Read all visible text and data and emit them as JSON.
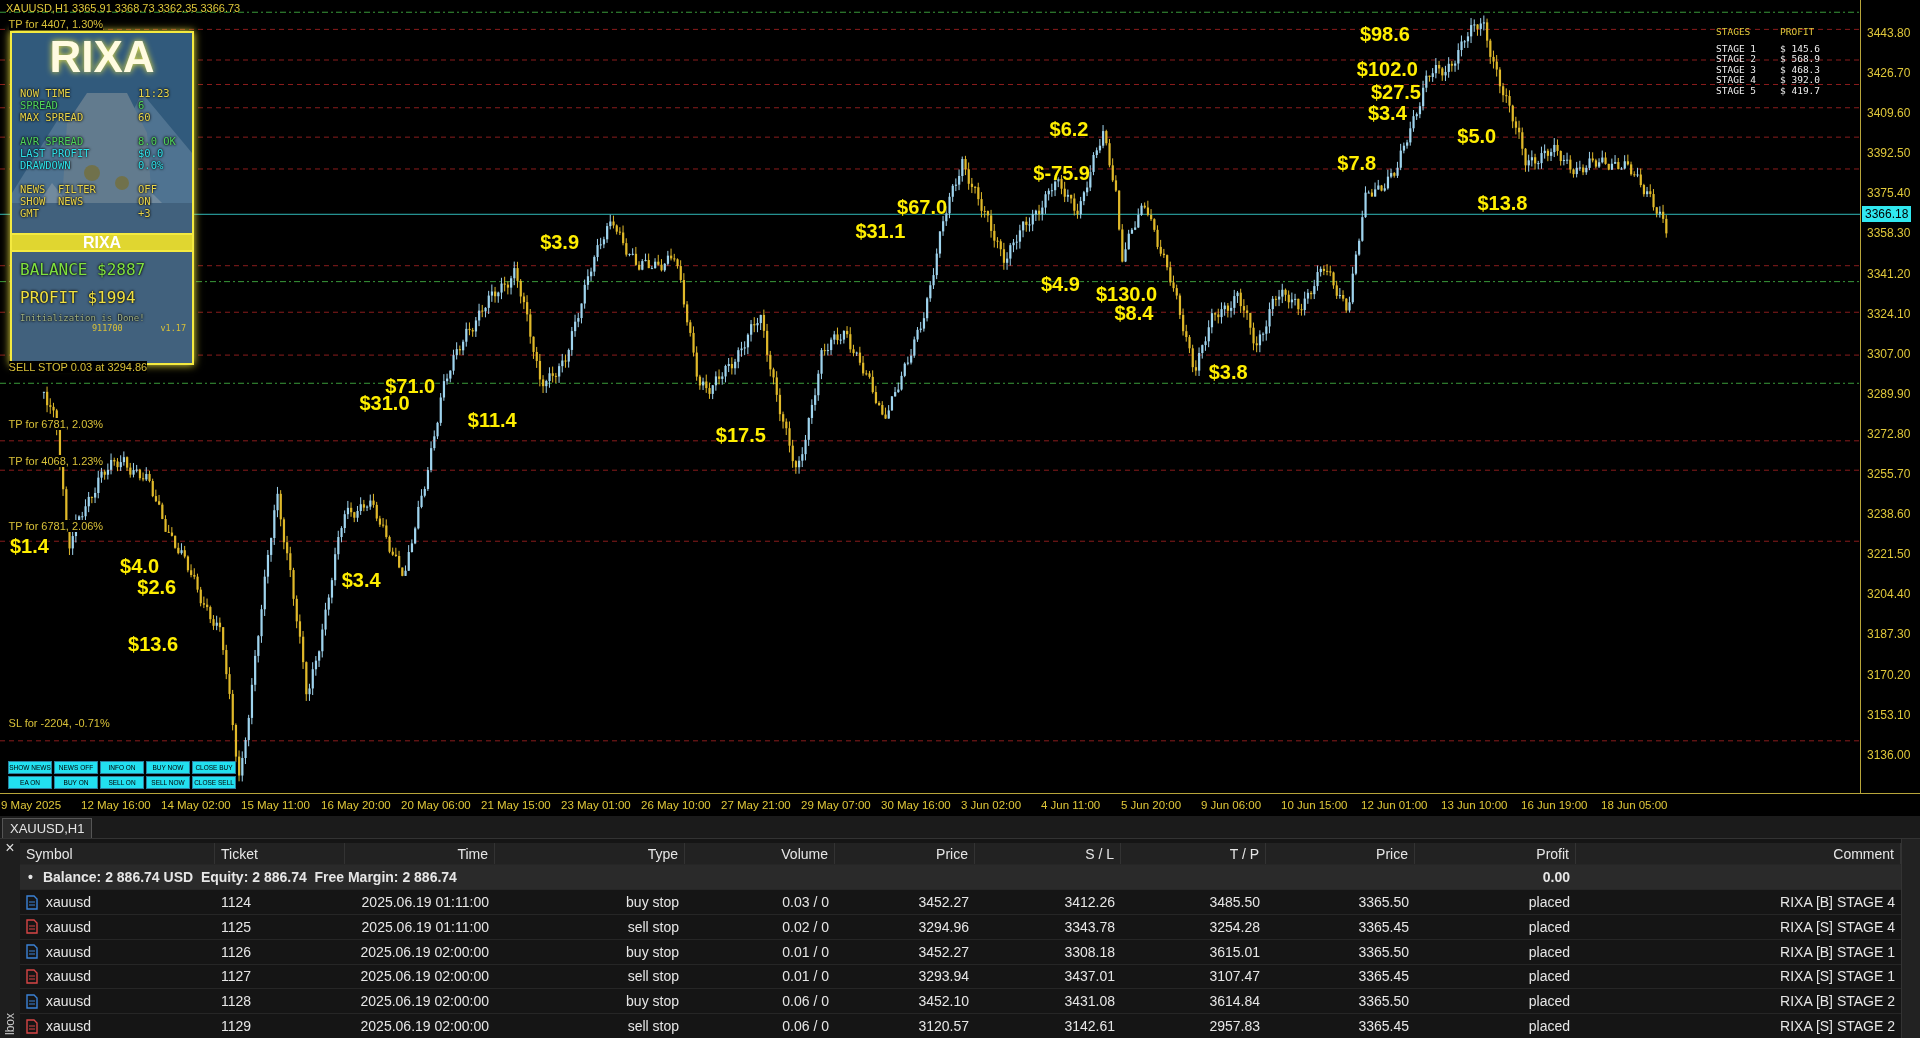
{
  "chart": {
    "header": "XAUUSD,H1 3365.91 3368.73 3362.35 3366.73",
    "order_lines": [
      "TP for 4407, 1.30%",
      "SELL STOP 0.03 at 3294.86",
      "TP for 6781, 2.03%",
      "TP for 4068, 1.23%",
      "TP for 6781, 2.06%",
      "SL for -2204, -0.71%"
    ],
    "profit_labels": [
      "$98.6",
      "$102.0",
      "$27.5",
      "$3.4",
      "$7.8",
      "$5.0",
      "$13.8",
      "$6.2",
      "$-75.9",
      "$4.9",
      "$130.0",
      "$8.4",
      "$3.8",
      "$31.1",
      "$67.0",
      "$3.9",
      "$71.0",
      "$31.0",
      "$11.4",
      "$17.5",
      "$3.4",
      "$1.4",
      "$4.0",
      "$2.6",
      "$13.6"
    ],
    "price_axis": [
      "3443.80",
      "3426.70",
      "3409.60",
      "3392.50",
      "3375.40",
      "3358.30",
      "3341.20",
      "3324.10",
      "3307.00",
      "3289.90",
      "3272.80",
      "3255.70",
      "3238.60",
      "3221.50",
      "3204.40",
      "3187.30",
      "3170.20",
      "3153.10",
      "3136.00"
    ],
    "current_price": "3366.18",
    "time_axis": [
      "9 May 2025",
      "12 May 16:00",
      "14 May 02:00",
      "15 May 11:00",
      "16 May 20:00",
      "20 May 06:00",
      "21 May 15:00",
      "23 May 01:00",
      "26 May 10:00",
      "27 May 21:00",
      "29 May 07:00",
      "30 May 16:00",
      "3 Jun 02:00",
      "4 Jun 11:00",
      "5 Jun 20:00",
      "9 Jun 06:00",
      "10 Jun 15:00",
      "12 Jun 01:00",
      "13 Jun 10:00",
      "16 Jun 19:00",
      "18 Jun 05:00"
    ]
  },
  "info_panel": {
    "title": "RIXA",
    "groups": [
      [
        {
          "label": "NOW TIME",
          "value": "11:23",
          "color": "#e8d44a"
        },
        {
          "label": "SPREAD",
          "value": "6",
          "color": "#4fd35a"
        },
        {
          "label": "MAX SPREAD",
          "value": "60",
          "color": "#e8d44a"
        }
      ],
      [
        {
          "label": "AVR SPREAD",
          "value": "8.0 OK",
          "color": "#4fd35a"
        },
        {
          "label": "LAST PROFIT",
          "value": "$0.0",
          "color": "#2ee0e8"
        },
        {
          "label": "DRAWDOWN",
          "value": "0.0%",
          "color": "#2ee0e8"
        }
      ],
      [
        {
          "label": "NEWS  FILTER",
          "value": "OFF",
          "color": "#e8d44a"
        },
        {
          "label": "SHOW  NEWS",
          "value": "ON",
          "color": "#e8d44a"
        },
        {
          "label": "GMT",
          "value": "+3",
          "color": "#e8d44a"
        }
      ]
    ],
    "band": "RIXA",
    "balance": "BALANCE $2887",
    "profit": "PROFIT  $1994",
    "status": "Initialization is Done!",
    "account": "911700",
    "version": "v1.17"
  },
  "stages": {
    "columns": [
      "STAGES",
      "PROFIT"
    ],
    "rows": [
      {
        "stage": "STAGE 1",
        "profit": "$ 145.6"
      },
      {
        "stage": "STAGE 2",
        "profit": "$ 568.9"
      },
      {
        "stage": "STAGE 3",
        "profit": "$ 468.3"
      },
      {
        "stage": "STAGE 4",
        "profit": "$ 392.0"
      },
      {
        "stage": "STAGE 5",
        "profit": "$ 419.7"
      }
    ]
  },
  "control_buttons": [
    "SHOW NEWS",
    "NEWS OFF",
    "INFO ON",
    "BUY NOW",
    "CLOSE BUY",
    "EA ON",
    "BUY ON",
    "SELL ON",
    "SELL NOW",
    "CLOSE SELL"
  ],
  "chart_tab": "XAUUSD,H1",
  "toolbox": {
    "close": "×",
    "side_label": "lbox",
    "columns": [
      "Symbol",
      "Ticket",
      "Time",
      "Type",
      "Volume",
      "Price",
      "S / L",
      "T / P",
      "Price",
      "Profit",
      "Comment"
    ],
    "summary": {
      "bullet": "•",
      "text": "Balance: 2 886.74 USD  Equity: 2 886.74  Free Margin: 2 886.74",
      "profit": "0.00"
    },
    "rows": [
      {
        "kind": "buy",
        "cells": [
          "xauusd",
          "1124",
          "2025.06.19 01:11:00",
          "buy stop",
          "0.03 / 0",
          "3452.27",
          "3412.26",
          "3485.50",
          "3365.50",
          "placed",
          "RIXA [B] STAGE 4"
        ]
      },
      {
        "kind": "sell",
        "cells": [
          "xauusd",
          "1125",
          "2025.06.19 01:11:00",
          "sell stop",
          "0.02 / 0",
          "3294.96",
          "3343.78",
          "3254.28",
          "3365.45",
          "placed",
          "RIXA [S] STAGE 4"
        ]
      },
      {
        "kind": "buy",
        "cells": [
          "xauusd",
          "1126",
          "2025.06.19 02:00:00",
          "buy stop",
          "0.01 / 0",
          "3452.27",
          "3308.18",
          "3615.01",
          "3365.50",
          "placed",
          "RIXA [B] STAGE 1"
        ]
      },
      {
        "kind": "sell",
        "cells": [
          "xauusd",
          "1127",
          "2025.06.19 02:00:00",
          "sell stop",
          "0.01 / 0",
          "3293.94",
          "3437.01",
          "3107.47",
          "3365.45",
          "placed",
          "RIXA [S] STAGE 1"
        ]
      },
      {
        "kind": "buy",
        "cells": [
          "xauusd",
          "1128",
          "2025.06.19 02:00:00",
          "buy stop",
          "0.06 / 0",
          "3452.10",
          "3431.08",
          "3614.84",
          "3365.50",
          "placed",
          "RIXA [B] STAGE 2"
        ]
      },
      {
        "kind": "sell",
        "cells": [
          "xauusd",
          "1129",
          "2025.06.19 02:00:00",
          "sell stop",
          "0.06 / 0",
          "3120.57",
          "3142.61",
          "2957.83",
          "3365.45",
          "placed",
          "RIXA [S] STAGE 2"
        ]
      }
    ]
  }
}
